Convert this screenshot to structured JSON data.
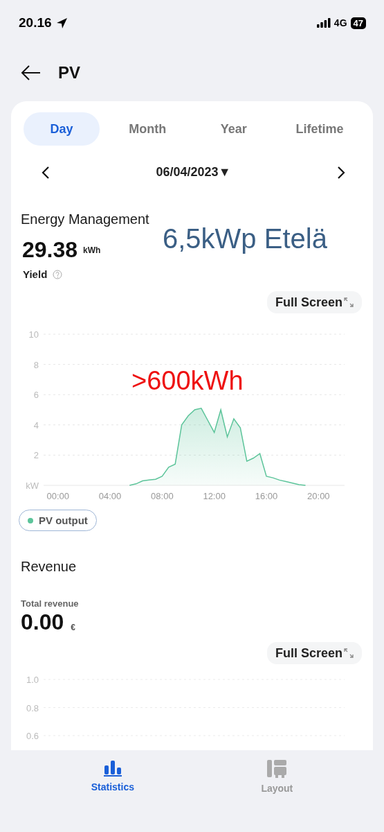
{
  "status_bar": {
    "time": "20.16",
    "network": "4G",
    "battery": "47"
  },
  "header": {
    "title": "PV"
  },
  "tabs": [
    {
      "label": "Day",
      "selected": true
    },
    {
      "label": "Month",
      "selected": false
    },
    {
      "label": "Year",
      "selected": false
    },
    {
      "label": "Lifetime",
      "selected": false
    }
  ],
  "date_picker": {
    "value": "06/04/2023",
    "caret": "▼"
  },
  "energy": {
    "title": "Energy Management",
    "value": "29.38",
    "unit": "kWh",
    "label": "Yield",
    "button": "Full Screen",
    "chart_data": {
      "type": "area",
      "x": [
        5.5,
        6,
        6.5,
        7,
        7.5,
        8,
        8.5,
        9,
        9.5,
        10,
        10.5,
        11,
        11.5,
        12,
        12.5,
        13,
        13.5,
        14,
        14.5,
        15,
        15.5,
        16,
        16.5,
        17,
        17.5,
        18,
        18.5,
        19
      ],
      "series": [
        {
          "name": "PV output",
          "color": "#5cc49a",
          "values": [
            0,
            0.1,
            0.3,
            0.35,
            0.4,
            0.6,
            1.2,
            1.4,
            4.0,
            4.6,
            5.0,
            5.1,
            4.3,
            3.5,
            5.0,
            3.2,
            4.4,
            3.8,
            1.6,
            1.8,
            2.1,
            0.6,
            0.5,
            0.35,
            0.25,
            0.15,
            0.05,
            0
          ]
        }
      ],
      "xlim": [
        -1.1,
        22
      ],
      "ylim": [
        0,
        10
      ],
      "grid": true,
      "xticks": [
        {
          "value": 0,
          "label": "00:00"
        },
        {
          "value": 4,
          "label": "04:00"
        },
        {
          "value": 8,
          "label": "08:00"
        },
        {
          "value": 12,
          "label": "12:00"
        },
        {
          "value": 16,
          "label": "16:00"
        },
        {
          "value": 20,
          "label": "20:00"
        }
      ],
      "yticks": [
        {
          "value": 0,
          "label": "kW"
        },
        2,
        4,
        6,
        8,
        10
      ]
    }
  },
  "overlay_notes": [
    {
      "text": "6,5kWp Etelä",
      "color": "#3b5f85",
      "kind": "title"
    },
    {
      "text": ">600kWh",
      "color": "#ee1111",
      "kind": "chart"
    }
  ],
  "revenue": {
    "title": "Revenue",
    "label": "Total revenue",
    "value": "0.00",
    "unit": "€",
    "button": "Full Screen",
    "y_axis_labels": [
      "1.0",
      "0.8",
      "0.6"
    ]
  },
  "bottom_nav": [
    {
      "label": "Statistics",
      "selected": true,
      "kind": "stats"
    },
    {
      "label": "Layout",
      "selected": false,
      "kind": "layout"
    }
  ]
}
